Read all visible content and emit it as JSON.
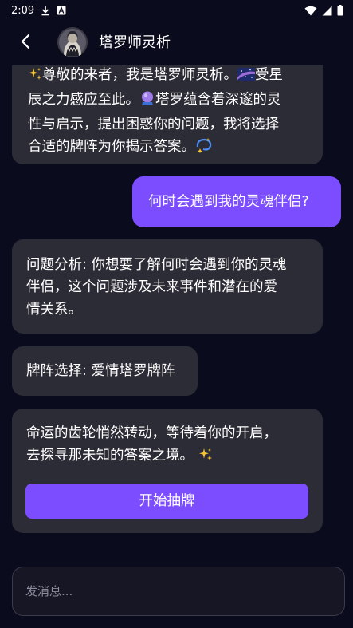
{
  "status_bar": {
    "time": "2:09",
    "icons": [
      "download-icon",
      "a-icon",
      "wifi-icon",
      "signal-icon",
      "battery-icon"
    ]
  },
  "header": {
    "title": "塔罗师灵析",
    "back_icon": "chevron-left-icon"
  },
  "messages": {
    "m1": {
      "line1_text": "尊敬的来者，我是塔罗师灵析。",
      "line1_tail": "受星",
      "line2_a": "辰之力感应至此。",
      "line2_b": "塔罗蕴含着深邃的灵",
      "line3": "性与启示，提出困惑你的问题，我将选择",
      "line4": "合适的牌阵为你揭示答案。"
    },
    "m2": {
      "text": "何时会遇到我的灵魂伴侣?"
    },
    "m3": {
      "line1": "问题分析: 你想要了解何时会遇到你的灵魂",
      "line2": "伴侣，这个问题涉及未来事件和潜在的爱",
      "line3": "情关系。"
    },
    "m4": {
      "text": "牌阵选择: 爱情塔罗牌阵"
    },
    "m5": {
      "line1": "命运的齿轮悄然转动，等待着你的开启，",
      "line2": "去探寻那未知的答案之境。",
      "button": "开始抽牌"
    }
  },
  "input": {
    "placeholder": "发消息..."
  },
  "colors": {
    "background": "#0b0b1e",
    "bot_bubble": "#2c2c37",
    "user_bubble": "#7c4dff",
    "button": "#7c4dff"
  }
}
